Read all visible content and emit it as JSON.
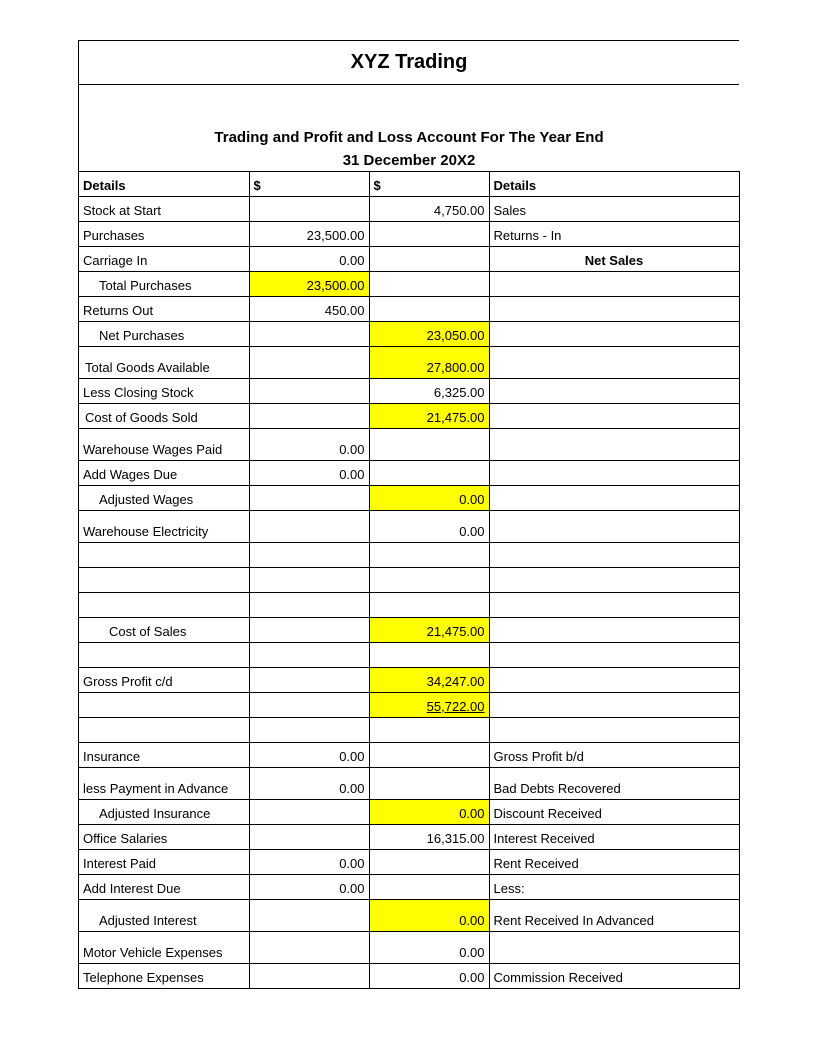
{
  "company": "XYZ Trading",
  "subtitle_line1": "Trading and Profit and Loss Account For The Year End",
  "subtitle_line2": "31 December 20X2",
  "headers": {
    "details_left": "Details",
    "col1": "$",
    "col2": "$",
    "details_right": "Details"
  },
  "rows": [
    {
      "a": "Stock at Start",
      "b": "",
      "c": "4,750.00",
      "d": "Sales"
    },
    {
      "a": "Purchases",
      "b": "23,500.00",
      "c": "",
      "d": "Returns - In"
    },
    {
      "a": "Carriage In",
      "b": "0.00",
      "c": "",
      "d": "Net Sales",
      "d_bold_center": true
    },
    {
      "a": "Total Purchases",
      "a_indent": 1,
      "b": "23,500.00",
      "b_hl": true,
      "c": "",
      "d": ""
    },
    {
      "a": "Returns Out",
      "b": "450.00",
      "c": "",
      "d": ""
    },
    {
      "a": "Net Purchases",
      "a_indent": 1,
      "b": "",
      "c": "23,050.00",
      "c_hl": true,
      "d": ""
    },
    {
      "a": " Total Goods Available",
      "a_lpad": true,
      "b": "",
      "c": "27,800.00",
      "c_hl": true,
      "d": "",
      "tall": true
    },
    {
      "a": "Less Closing Stock",
      "b": "",
      "c": "6,325.00",
      "d": ""
    },
    {
      "a": "Cost of Goods Sold",
      "a_lpad": true,
      "b": "",
      "c": "21,475.00",
      "c_hl": true,
      "d": ""
    },
    {
      "a": "Warehouse Wages Paid",
      "a_wrap": true,
      "b": "0.00",
      "c": "",
      "d": "",
      "tall": true
    },
    {
      "a": "Add Wages Due",
      "b": "0.00",
      "c": "",
      "d": ""
    },
    {
      "a": "Adjusted Wages",
      "a_indent": 1,
      "b": "",
      "c": "0.00",
      "c_hl": true,
      "d": ""
    },
    {
      "a": "Warehouse Electricity",
      "b": "",
      "c": "0.00",
      "d": "",
      "tall": true
    },
    {
      "a": "",
      "b": "",
      "c": "",
      "d": ""
    },
    {
      "a": "",
      "b": "",
      "c": "",
      "d": ""
    },
    {
      "a": "",
      "b": "",
      "c": "",
      "d": ""
    },
    {
      "a": "Cost of Sales",
      "a_indent": 2,
      "b": "",
      "c": "21,475.00",
      "c_hl": true,
      "d": ""
    },
    {
      "a": "",
      "b": "",
      "c": "",
      "d": ""
    },
    {
      "a": "Gross Profit c/d",
      "b": "",
      "c": "34,247.00",
      "c_hl": true,
      "d": ""
    },
    {
      "a": "",
      "b": "",
      "c": "55,722.00",
      "c_hl": true,
      "c_uline": true,
      "d": ""
    },
    {
      "a": "",
      "b": "",
      "c": "",
      "d": ""
    },
    {
      "a": "Insurance",
      "b": "0.00",
      "c": "",
      "d": "Gross Profit b/d"
    },
    {
      "a": "less Payment in Advance",
      "a_wrap": true,
      "b": "0.00",
      "c": "",
      "d": "Bad Debts Recovered",
      "tall": true
    },
    {
      "a": "Adjusted Insurance",
      "a_indent": 1,
      "b": "",
      "c": "0.00",
      "c_hl": true,
      "d": "Discount Received"
    },
    {
      "a": "Office Salaries",
      "b": "",
      "c": "16,315.00",
      "d": "Interest Received"
    },
    {
      "a": "Interest Paid",
      "b": "0.00",
      "c": "",
      "d": "Rent Received"
    },
    {
      "a": "Add Interest Due",
      "b": "0.00",
      "c": "",
      "d": "Less:"
    },
    {
      "a": "Adjusted Interest",
      "a_indent": 1,
      "b": "",
      "c": "0.00",
      "c_hl": true,
      "d": "Rent Received In Advanced",
      "tall": true
    },
    {
      "a": "Motor Vehicle Expenses",
      "a_wrap": true,
      "b": "",
      "c": "0.00",
      "d": "",
      "tall": true
    },
    {
      "a": "Telephone Expenses",
      "b": "",
      "c": "0.00",
      "d": "Commission Received"
    }
  ]
}
